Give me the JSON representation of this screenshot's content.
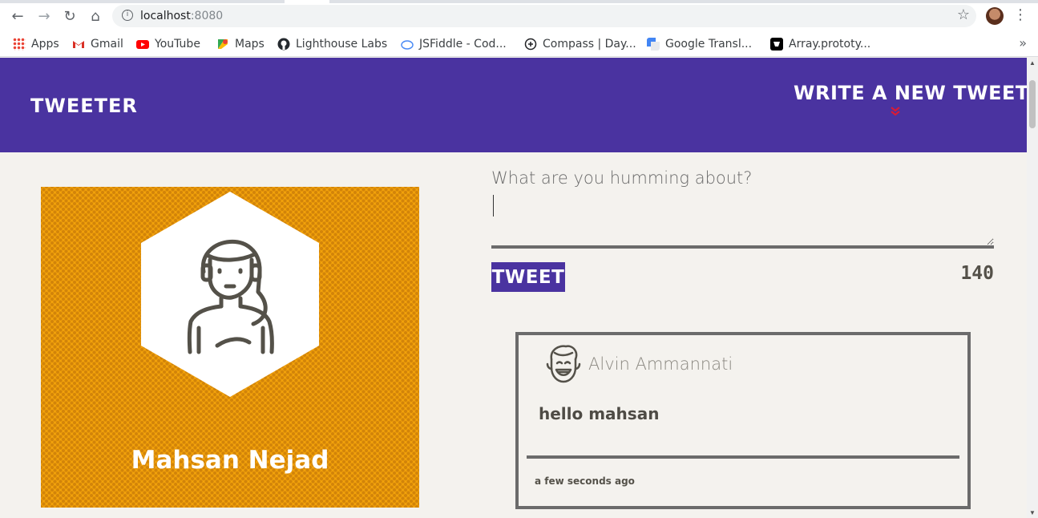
{
  "browser": {
    "url_host": "localhost",
    "url_port": ":8080",
    "nav": {
      "back_icon": "←",
      "forward_icon": "→",
      "reload_icon": "↻",
      "home_icon": "⌂",
      "star_icon": "☆",
      "menu_icon": "⋮",
      "info_icon": "i"
    },
    "bookmarks": [
      {
        "label": "Apps",
        "color": "#ea4335"
      },
      {
        "label": "Gmail",
        "color": "#d93025"
      },
      {
        "label": "YouTube",
        "color": "#ff0000"
      },
      {
        "label": "Maps",
        "color": "#34a853"
      },
      {
        "label": "Lighthouse Labs",
        "color": "#24292e"
      },
      {
        "label": "JSFiddle - Cod...",
        "color": "#4b8bf5"
      },
      {
        "label": "Compass | Day...",
        "color": "#202124"
      },
      {
        "label": "Google Transl...",
        "color": "#4285f4"
      },
      {
        "label": "Array.prototy...",
        "color": "#000000"
      }
    ],
    "more_icon": "»"
  },
  "header": {
    "brand": "Tweeter",
    "compose_label": "Write a new tweet",
    "compose_arrow": "»"
  },
  "profile": {
    "name": "Mahsan Nejad"
  },
  "composer": {
    "placeholder": "What are you humming about?",
    "tweet_button": "Tweet",
    "counter": "140"
  },
  "tweets": [
    {
      "author": "Alvin Ammannati",
      "text": "hello mahsan",
      "timestamp": "a few seconds ago"
    }
  ],
  "colors": {
    "nav_purple": "#4a33a0",
    "background": "#f4f2ee",
    "profile_orange": "#f2a20b",
    "text_dark": "#545149"
  }
}
